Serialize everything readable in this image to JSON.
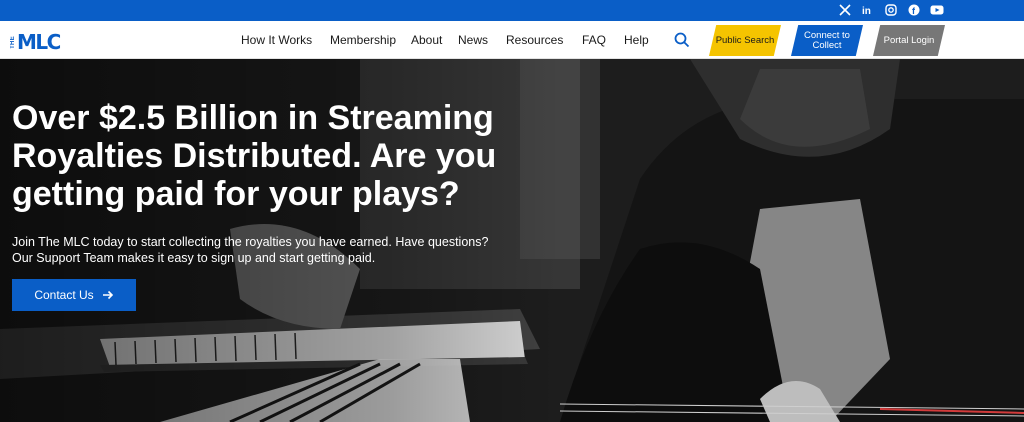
{
  "social": {
    "icons": [
      "x-icon",
      "linkedin-icon",
      "instagram-icon",
      "facebook-icon",
      "youtube-icon"
    ]
  },
  "header": {
    "logo_small": "THE",
    "logo_main": "MLC",
    "nav": [
      {
        "label": "How It Works"
      },
      {
        "label": "Membership"
      },
      {
        "label": "About"
      },
      {
        "label": "News"
      },
      {
        "label": "Resources"
      },
      {
        "label": "FAQ"
      },
      {
        "label": "Help"
      }
    ],
    "cta": {
      "public_search": "Public Search",
      "connect": "Connect to Collect",
      "portal": "Portal Login"
    }
  },
  "hero": {
    "headline": "Over $2.5 Billion in Streaming Royalties Distributed. Are you getting paid for your plays?",
    "subtext_line1": "Join The MLC today to start collecting the royalties you have earned. Have questions?",
    "subtext_line2": "Our Support Team makes it easy to sign up and start getting paid.",
    "button_label": "Contact Us"
  },
  "colors": {
    "brand_blue": "#0a5ec7",
    "public_search_yellow": "#f5c400",
    "portal_gray": "#777777"
  }
}
